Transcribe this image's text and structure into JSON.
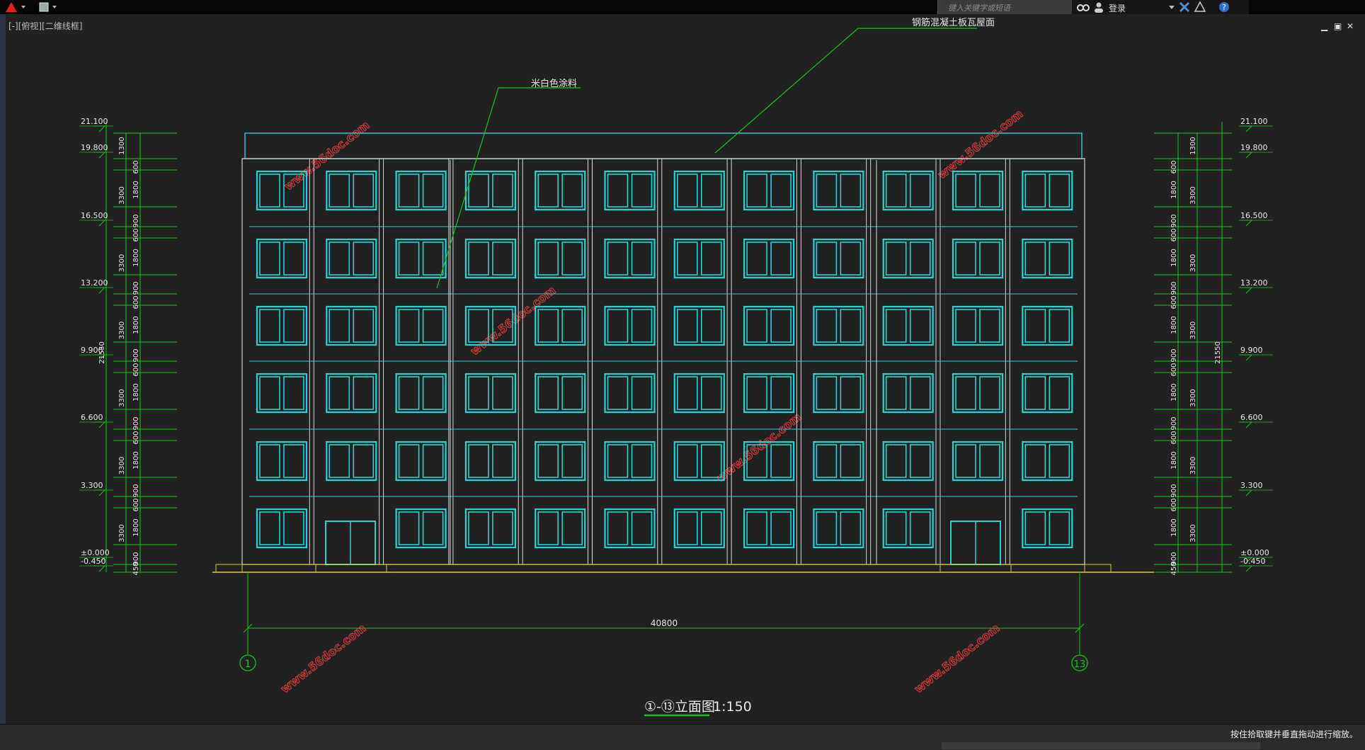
{
  "app": {
    "search_placeholder": "键入关键字或短语",
    "login_label": "登录",
    "view_label": "[-][俯视][二维线框]",
    "status_hint": "按住拾取键并垂直拖动进行缩放。"
  },
  "drawing": {
    "title": "①-⑬立面图",
    "scale": "1:150",
    "annotation_paint": "米白色涂料",
    "annotation_roof": "钢筋混凝土板瓦屋面",
    "overall_dim": "40800",
    "axis_start": "1",
    "axis_end": "13",
    "total_height_left": "21550",
    "total_height_right": "21550",
    "elevations": [
      "21.100",
      "19.800",
      "16.500",
      "13.200",
      "9.900",
      "6.600",
      "3.300",
      "±0.000",
      "-0.450"
    ],
    "segment_dims_floor": [
      "900",
      "1800",
      "600"
    ],
    "floor_height": "3300",
    "parapet_dim": "1300",
    "base_dim": "450",
    "watermark": "www.56doc.com",
    "colors": {
      "line_green": "#17c11a",
      "window_cyan": "#25d3d3",
      "wall_white": "#d8d8d8",
      "roof_cyan": "#3ac8d8",
      "ground_yellow": "#d6c84a"
    }
  }
}
